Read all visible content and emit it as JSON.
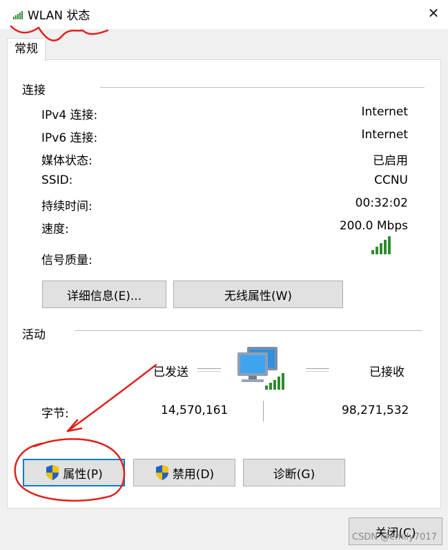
{
  "window": {
    "title": "WLAN 状态",
    "close_glyph": "✕"
  },
  "tabs": [
    {
      "label": "常规"
    }
  ],
  "connection": {
    "section_title": "连接",
    "rows": [
      {
        "label": "IPv4 连接:",
        "value": "Internet"
      },
      {
        "label": "IPv6 连接:",
        "value": "Internet"
      },
      {
        "label": "媒体状态:",
        "value": "已启用"
      },
      {
        "label": "SSID:",
        "value": "CCNU"
      },
      {
        "label": "持续时间:",
        "value": "00:32:02"
      },
      {
        "label": "速度:",
        "value": "200.0 Mbps"
      }
    ],
    "signal_label": "信号质量:",
    "signal_bars": 5,
    "signal_max": 5,
    "buttons": {
      "details": "详细信息(E)...",
      "wireless_props": "无线属性(W)"
    }
  },
  "activity": {
    "section_title": "活动",
    "sent_label": "已发送",
    "received_label": "已接收",
    "bytes_label": "字节:",
    "bytes_sent": "14,570,161",
    "bytes_received": "98,271,532"
  },
  "action_buttons": {
    "properties": "属性(P)",
    "disable": "禁用(D)",
    "diagnose": "诊断(G)"
  },
  "footer": {
    "close": "关闭(C)"
  },
  "watermark": "CSDN @emily7017",
  "colors": {
    "signal_green": "#2e8b2e",
    "focus_blue": "#0078d7",
    "annotation_red": "#e0201a",
    "button_face": "#e1e1e1"
  },
  "icons": [
    "wifi-signal-icon",
    "close-icon",
    "network-computers-icon",
    "uac-shield-icon"
  ]
}
